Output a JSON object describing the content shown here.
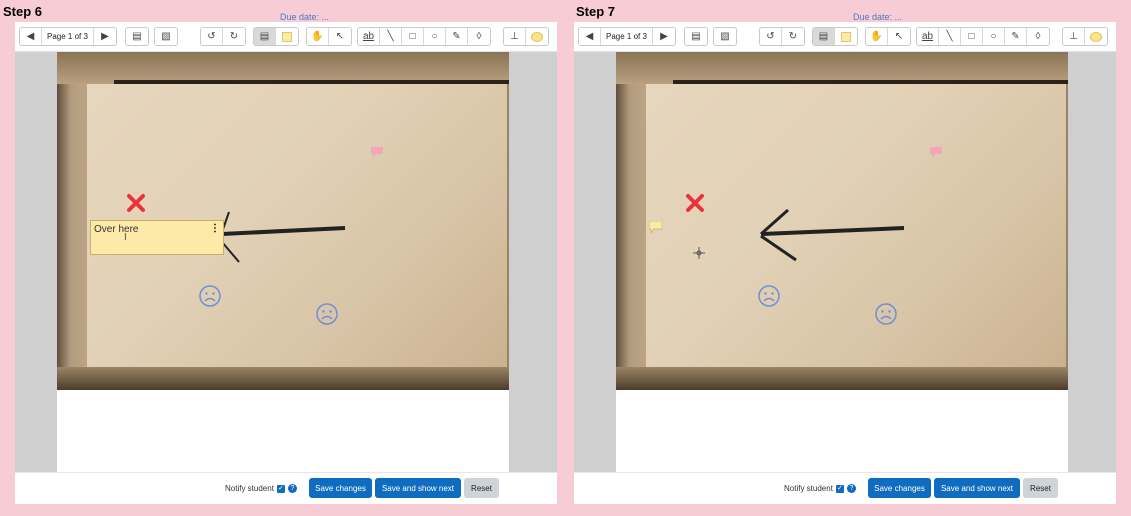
{
  "steps": [
    {
      "title": "Step 6",
      "caption": "Due date: ...",
      "toolbar": {
        "page_label": "Page 1 of 3"
      },
      "sticky_note": {
        "text": "Over here",
        "menu": "⋮"
      },
      "footer": {
        "notify_label": "Notify student",
        "save_changes": "Save changes",
        "save_and_show_next": "Save and show next",
        "reset": "Reset"
      }
    },
    {
      "title": "Step 7",
      "caption": "Due date: ...",
      "toolbar": {
        "page_label": "Page 1 of 3"
      },
      "footer": {
        "notify_label": "Notify student",
        "save_changes": "Save changes",
        "save_and_show_next": "Save and show next",
        "reset": "Reset"
      }
    }
  ],
  "colors": {
    "accent": "#0f6cbf",
    "background": "#f7ccd4",
    "stamp_cross": "#e8333c",
    "stamp_sad": "#6d8fd6",
    "comment_pink": "#f3a7b6",
    "comment_yellow": "#fde9a8"
  },
  "icons": [
    "prev-page-icon",
    "next-page-icon",
    "search-comments-icon",
    "expand-comments-icon",
    "rotate-left-icon",
    "rotate-right-icon",
    "comment-tool-icon",
    "comment-color-icon",
    "pan-tool-icon",
    "select-tool-icon",
    "highlight-tool-icon",
    "line-tool-icon",
    "rectangle-tool-icon",
    "oval-tool-icon",
    "pen-tool-icon",
    "eraser-color-icon",
    "stamp-tool-icon",
    "stamp-picker-icon",
    "cross-stamp-icon",
    "sad-face-stamp-icon",
    "comment-marker-icon"
  ]
}
